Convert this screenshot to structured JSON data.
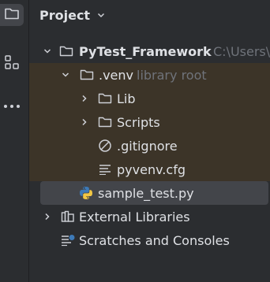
{
  "panel": {
    "title": "Project"
  },
  "tree": {
    "root": {
      "name": "PyTest_Framework",
      "path": "C:\\Users\\"
    },
    "venv": {
      "name": ".venv",
      "hint": "library root"
    },
    "lib": {
      "name": "Lib"
    },
    "scripts": {
      "name": "Scripts"
    },
    "gitignore": {
      "name": ".gitignore"
    },
    "pyvenv": {
      "name": "pyvenv.cfg"
    },
    "sample": {
      "name": "sample_test.py"
    },
    "external": {
      "name": "External Libraries"
    },
    "scratches": {
      "name": "Scratches and Consoles"
    }
  },
  "icons": {
    "tool_window": "folder-icon",
    "structure": "structure-icon",
    "more": "more-icon",
    "python": "python-icon",
    "gitignore": "ignored-file-icon",
    "config": "text-file-icon",
    "library": "library-icon",
    "scratch": "scratch-icon"
  },
  "colors": {
    "background": "#2b2d30",
    "excluded_row": "#3c3428",
    "selected_row": "#43454a",
    "text": "#dfe1e5",
    "hint": "#6f737a",
    "python_blue": "#3d7ab8",
    "python_yellow": "#f2c744"
  }
}
